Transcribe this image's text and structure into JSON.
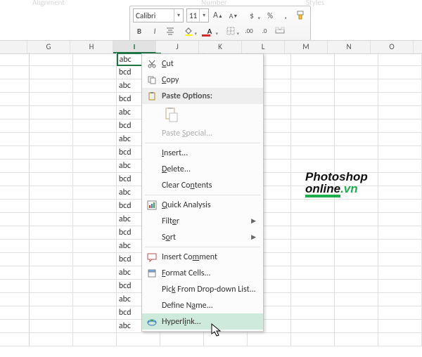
{
  "ghostLabels": {
    "alignment": "Alignment",
    "number": "Number",
    "styles": "Styles"
  },
  "toolbar": {
    "font": "Calibri",
    "size": "11",
    "bold": "B",
    "italic": "I"
  },
  "columns": [
    "G",
    "H",
    "I",
    "J",
    "K",
    "L",
    "M",
    "N",
    "O"
  ],
  "activeCol": "I",
  "cells": [
    "abc",
    "bcd",
    "abc",
    "bcd",
    "abc",
    "bcd",
    "abc",
    "bcd",
    "abc",
    "bcd",
    "abc",
    "bcd",
    "abc",
    "bcd",
    "abc",
    "bcd",
    "abc",
    "bcd",
    "abc",
    "bcd",
    "abc"
  ],
  "menu": {
    "cut": "Cut",
    "copy": "Copy",
    "pasteOptions": "Paste Options:",
    "pasteSpecial": "Paste Special...",
    "insert": "Insert...",
    "delete": "Delete...",
    "clear": "Clear Contents",
    "quick": "Quick Analysis",
    "filter": "Filter",
    "sort": "Sort",
    "comment": "Insert Comment",
    "format": "Format Cells...",
    "pick": "Pick From Drop-down List...",
    "define": "Define Name...",
    "hyperlink": "Hyperlink..."
  },
  "watermark": {
    "l1": "Photoshop",
    "l2": "online",
    "l3": ".vn"
  }
}
